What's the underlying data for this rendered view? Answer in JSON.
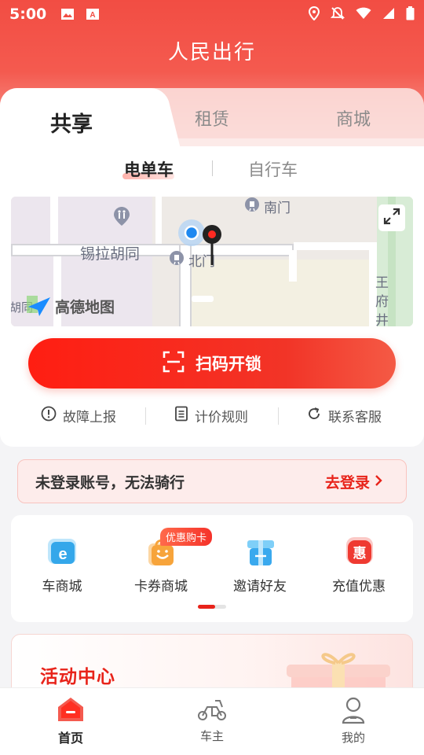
{
  "status_bar": {
    "time": "5:00"
  },
  "app_title": "人民出行",
  "tabs": [
    {
      "label": "共享",
      "active": true
    },
    {
      "label": "租赁"
    },
    {
      "label": "商城"
    }
  ],
  "subtabs": [
    {
      "label": "电单车",
      "active": true
    },
    {
      "label": "自行车"
    }
  ],
  "map": {
    "labels": {
      "south_gate": "南门",
      "north_gate": "北门",
      "street": "锡拉胡同",
      "hutong_fragment": "胡同",
      "amap_logo": "高德地图",
      "wangfujing": "王府井"
    }
  },
  "scan_button": {
    "label": "扫码开锁"
  },
  "links": [
    {
      "label": "故障上报",
      "icon": "alert-circle-icon"
    },
    {
      "label": "计价规则",
      "icon": "document-icon"
    },
    {
      "label": "联系客服",
      "icon": "refresh-icon"
    }
  ],
  "login_banner": {
    "text": "未登录账号，无法骑行",
    "action": "去登录"
  },
  "grid": {
    "items": [
      {
        "label": "车商城",
        "icon": "car-mall-icon"
      },
      {
        "label": "卡券商城",
        "icon": "coupon-bag-icon"
      },
      {
        "label": "邀请好友",
        "icon": "gift-icon"
      },
      {
        "label": "充值优惠",
        "icon": "discount-icon"
      }
    ],
    "badge": "优惠购卡"
  },
  "activity": {
    "title": "活动中心"
  },
  "bottom_nav": [
    {
      "label": "首页",
      "icon": "home-icon",
      "active": true
    },
    {
      "label": "车主",
      "icon": "scooter-icon"
    },
    {
      "label": "我的",
      "icon": "person-icon"
    }
  ],
  "colors": {
    "accent": "#e8231a",
    "header": "#f24d43"
  }
}
